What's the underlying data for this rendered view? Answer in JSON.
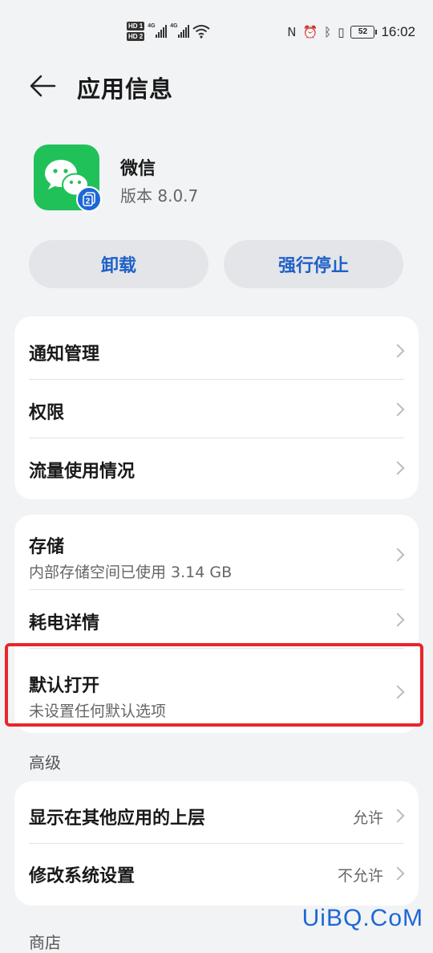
{
  "status_bar": {
    "sim1": "HD 1",
    "sim2": "HD 2",
    "net1": "4G",
    "net2": "4G",
    "battery": "52",
    "time": "16:02"
  },
  "header": {
    "title": "应用信息"
  },
  "app": {
    "name": "微信",
    "version": "版本 8.0.7",
    "badge": "2"
  },
  "actions": {
    "uninstall": "卸载",
    "force_stop": "强行停止"
  },
  "card1": {
    "items": [
      {
        "label": "通知管理"
      },
      {
        "label": "权限"
      },
      {
        "label": "流量使用情况"
      }
    ]
  },
  "card2": {
    "items": [
      {
        "label": "存储",
        "sub": "内部存储空间已使用 3.14 GB"
      },
      {
        "label": "耗电详情"
      },
      {
        "label": "默认打开",
        "sub": "未设置任何默认选项"
      }
    ]
  },
  "advanced": {
    "section_label": "高级",
    "items": [
      {
        "label": "显示在其他应用的上层",
        "value": "允许"
      },
      {
        "label": "修改系统设置",
        "value": "不允许"
      }
    ]
  },
  "next_section_label": "商店",
  "watermark": "UiBQ.CoM",
  "colors": {
    "accent": "#1e60c8",
    "highlight": "#e8252a",
    "wechat_green": "#21c15a"
  }
}
